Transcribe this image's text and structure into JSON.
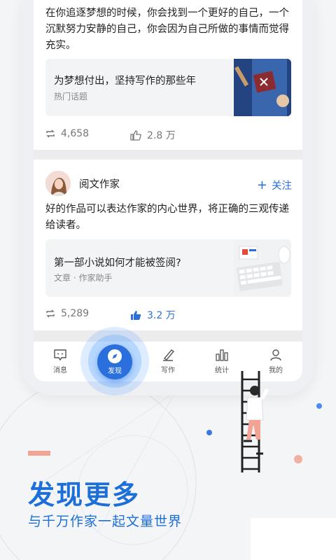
{
  "colors": {
    "accent": "#2a6fdb",
    "headline": "#1c6ed8",
    "coral": "#f2a394"
  },
  "feed": {
    "card1": {
      "text": "在你追逐梦想的时候，你会找到一个更好的自己，一个沉默努力安静的自己，你会因为自己所做的事情而觉得充实。",
      "link_title": "为梦想付出，坚持写作的那些年",
      "link_sub": "热门话题",
      "reposts": "4,658",
      "likes": "2.8 万"
    },
    "card2": {
      "author": "阅文作家",
      "follow": "关注",
      "text": "好的作品可以表达作家的内心世界，将正确的三观传递给读者。",
      "link_title": "第一部小说如何才能被签阅?",
      "link_sub": "文章 · 作家助手",
      "reposts": "5,289",
      "likes": "3.2 万"
    }
  },
  "tabbar": {
    "items": [
      {
        "label": "消息",
        "icon": "message-icon"
      },
      {
        "label": "发现",
        "icon": "compass-icon",
        "active": true
      },
      {
        "label": "写作",
        "icon": "pen-icon"
      },
      {
        "label": "统计",
        "icon": "chart-icon"
      },
      {
        "label": "我的",
        "icon": "user-icon"
      }
    ]
  },
  "promo": {
    "headline": "发现更多",
    "subline": "与千万作家一起文量世界"
  }
}
